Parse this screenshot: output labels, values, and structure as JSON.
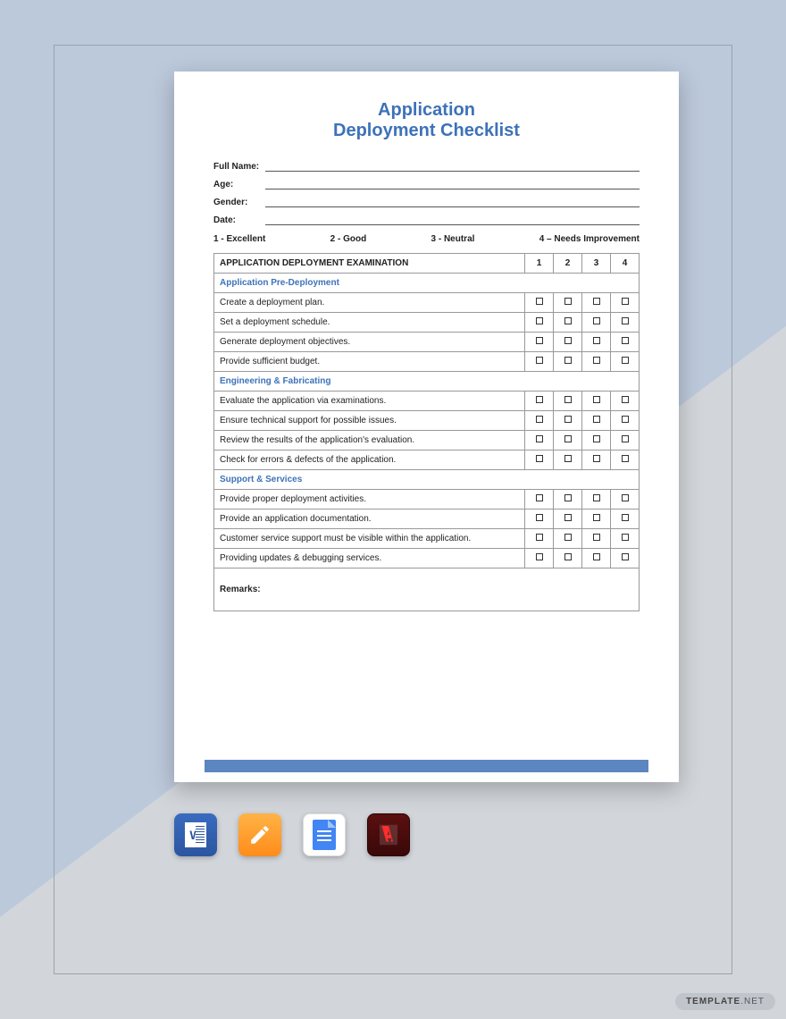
{
  "title_line1": "Application",
  "title_line2": "Deployment Checklist",
  "fields": {
    "full_name": "Full Name:",
    "age": "Age:",
    "gender": "Gender:",
    "date": "Date:"
  },
  "scale": {
    "s1": "1 - Excellent",
    "s2": "2 - Good",
    "s3": "3 - Neutral",
    "s4": "4 – Needs Improvement"
  },
  "table": {
    "header": "APPLICATION DEPLOYMENT EXAMINATION",
    "c1": "1",
    "c2": "2",
    "c3": "3",
    "c4": "4",
    "section1": "Application Pre-Deployment",
    "section2": "Engineering & Fabricating",
    "section3": "Support & Services",
    "rows": {
      "r1": "Create a deployment plan.",
      "r2": "Set a deployment schedule.",
      "r3": "Generate deployment objectives.",
      "r4": "Provide sufficient budget.",
      "r5": "Evaluate the application via examinations.",
      "r6": "Ensure technical support for possible issues.",
      "r7": "Review the results of the application's evaluation.",
      "r8": "Check for errors & defects of the application.",
      "r9": "Provide proper deployment activities.",
      "r10": "Provide an application documentation.",
      "r11": "Customer service support must be visible within the application.",
      "r12": "Providing updates & debugging services."
    },
    "remarks": "Remarks:"
  },
  "watermark": {
    "brand": "TEMPLATE",
    "suffix": ".NET"
  }
}
